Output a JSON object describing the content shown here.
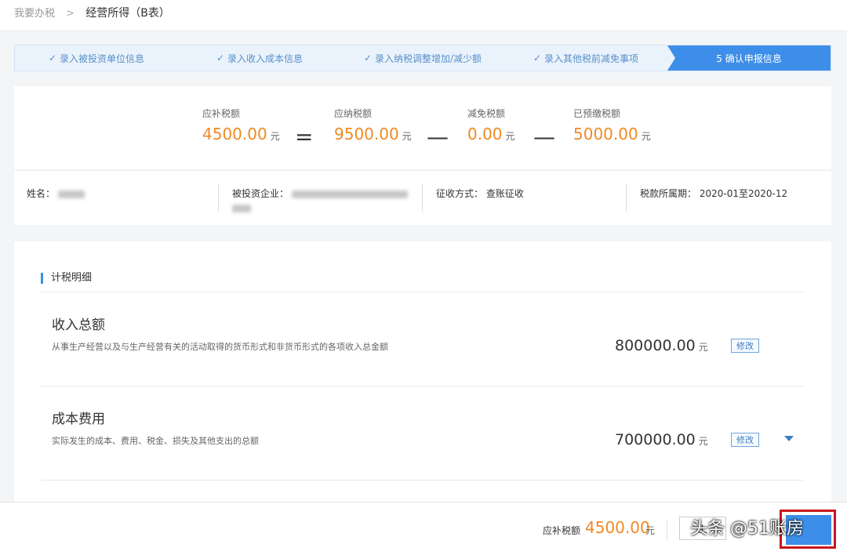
{
  "breadcrumb": {
    "parent": "我要办税",
    "current": "经营所得（B表）"
  },
  "steps": [
    {
      "label": "录入被投资单位信息"
    },
    {
      "label": "录入收入成本信息"
    },
    {
      "label": "录入纳税调整增加/减少额"
    },
    {
      "label": "录入其他税前减免事项"
    },
    {
      "label": "5 确认申报信息"
    }
  ],
  "summary": {
    "payable": {
      "label": "应补税额",
      "value": "4500.00",
      "unit": "元"
    },
    "due": {
      "label": "应纳税额",
      "value": "9500.00",
      "unit": "元"
    },
    "relief": {
      "label": "减免税额",
      "value": "0.00",
      "unit": "元"
    },
    "prepaid": {
      "label": "已预缴税额",
      "value": "5000.00",
      "unit": "元"
    },
    "eq": "=",
    "minus": "—"
  },
  "info": {
    "name_label": "姓名：",
    "company_label": "被投资企业：",
    "method_label": "征收方式：",
    "method_value": "查账征收",
    "period_label": "税款所属期：",
    "period_value": "2020-01至2020-12"
  },
  "detail": {
    "title": "计税明细",
    "rows": [
      {
        "title": "收入总额",
        "desc": "从事生产经营以及与生产经营有关的活动取得的货币形式和非货币形式的各项收入总金额",
        "amount": "800000.00",
        "unit": "元",
        "edit": "修改"
      },
      {
        "title": "成本费用",
        "desc": "实际发生的成本、费用、税金、损失及其他支出的总额",
        "amount": "700000.00",
        "unit": "元",
        "edit": "修改"
      }
    ]
  },
  "footer": {
    "label": "应补税额",
    "value": "4500.00",
    "unit": "元",
    "prev_label": "上",
    "watermark": "头条 @51账房"
  },
  "colors": {
    "accent": "#3d8ee8",
    "amount": "#f08a24",
    "highlight": "#c8161d"
  }
}
